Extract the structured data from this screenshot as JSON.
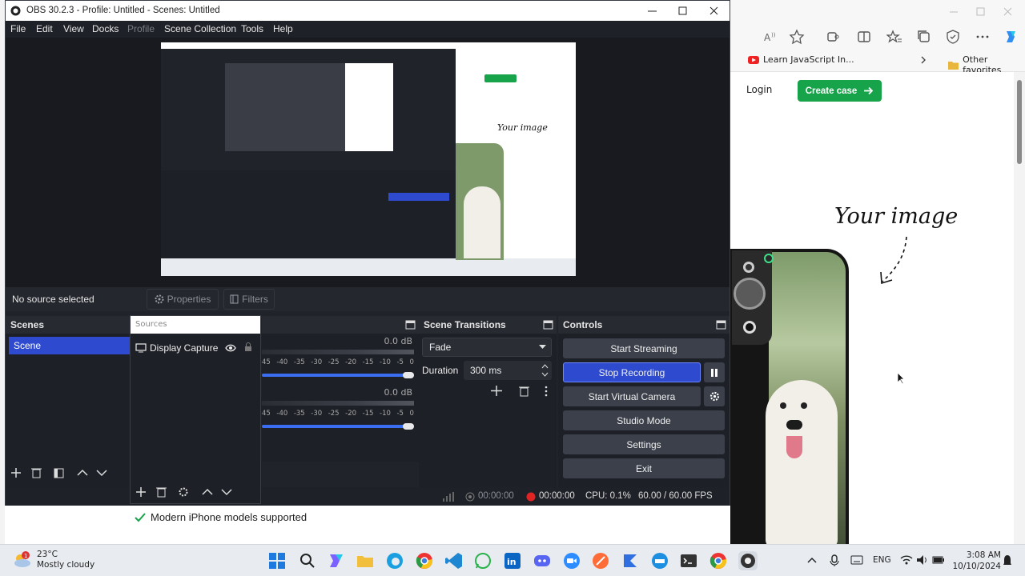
{
  "obs": {
    "title": "OBS 30.2.3 - Profile: Untitled - Scenes: Untitled",
    "menu": [
      "File",
      "Edit",
      "View",
      "Docks",
      "Profile",
      "Scene Collection",
      "Tools",
      "Help"
    ],
    "no_source": "No source selected",
    "properties_label": "Properties",
    "filters_label": "Filters",
    "scenes": {
      "title": "Scenes",
      "items": [
        "Scene"
      ]
    },
    "sources": {
      "title": "Sources",
      "items": [
        "Display Capture"
      ]
    },
    "mixer": {
      "db1": "0.0 dB",
      "db2": "0.0 dB",
      "ticks": [
        "45",
        "-40",
        "-35",
        "-30",
        "-25",
        "-20",
        "-15",
        "-10",
        "-5",
        "0"
      ],
      "volume_fraction": 1.0
    },
    "transitions": {
      "title": "Scene Transitions",
      "selected": "Fade",
      "duration_label": "Duration",
      "duration_value": "300 ms"
    },
    "controls": {
      "title": "Controls",
      "start_streaming": "Start Streaming",
      "stop_recording": "Stop Recording",
      "start_virtual_camera": "Start Virtual Camera",
      "studio_mode": "Studio Mode",
      "settings": "Settings",
      "exit": "Exit"
    },
    "status": {
      "stream_time": "00:00:00",
      "rec_time": "00:00:00",
      "cpu": "CPU: 0.1%",
      "fps": "60.00 / 60.00 FPS"
    }
  },
  "browser": {
    "fav_item": "Learn JavaScript In...",
    "other_favorites": "Other favorites",
    "login": "Login",
    "create_case": "Create case",
    "your_image": "Your image"
  },
  "underlying_page": {
    "iphone_note": "Modern iPhone models supported"
  },
  "taskbar": {
    "weather_temp": "23°C",
    "weather_desc": "Mostly cloudy",
    "weather_badge": "1",
    "lang": "ENG",
    "time": "3:08 AM",
    "date": "10/10/2024"
  },
  "colors": {
    "obs_bg": "#202329",
    "obs_active": "#2e4bd0",
    "record_red": "#e02424",
    "create_green": "#16a34a"
  }
}
